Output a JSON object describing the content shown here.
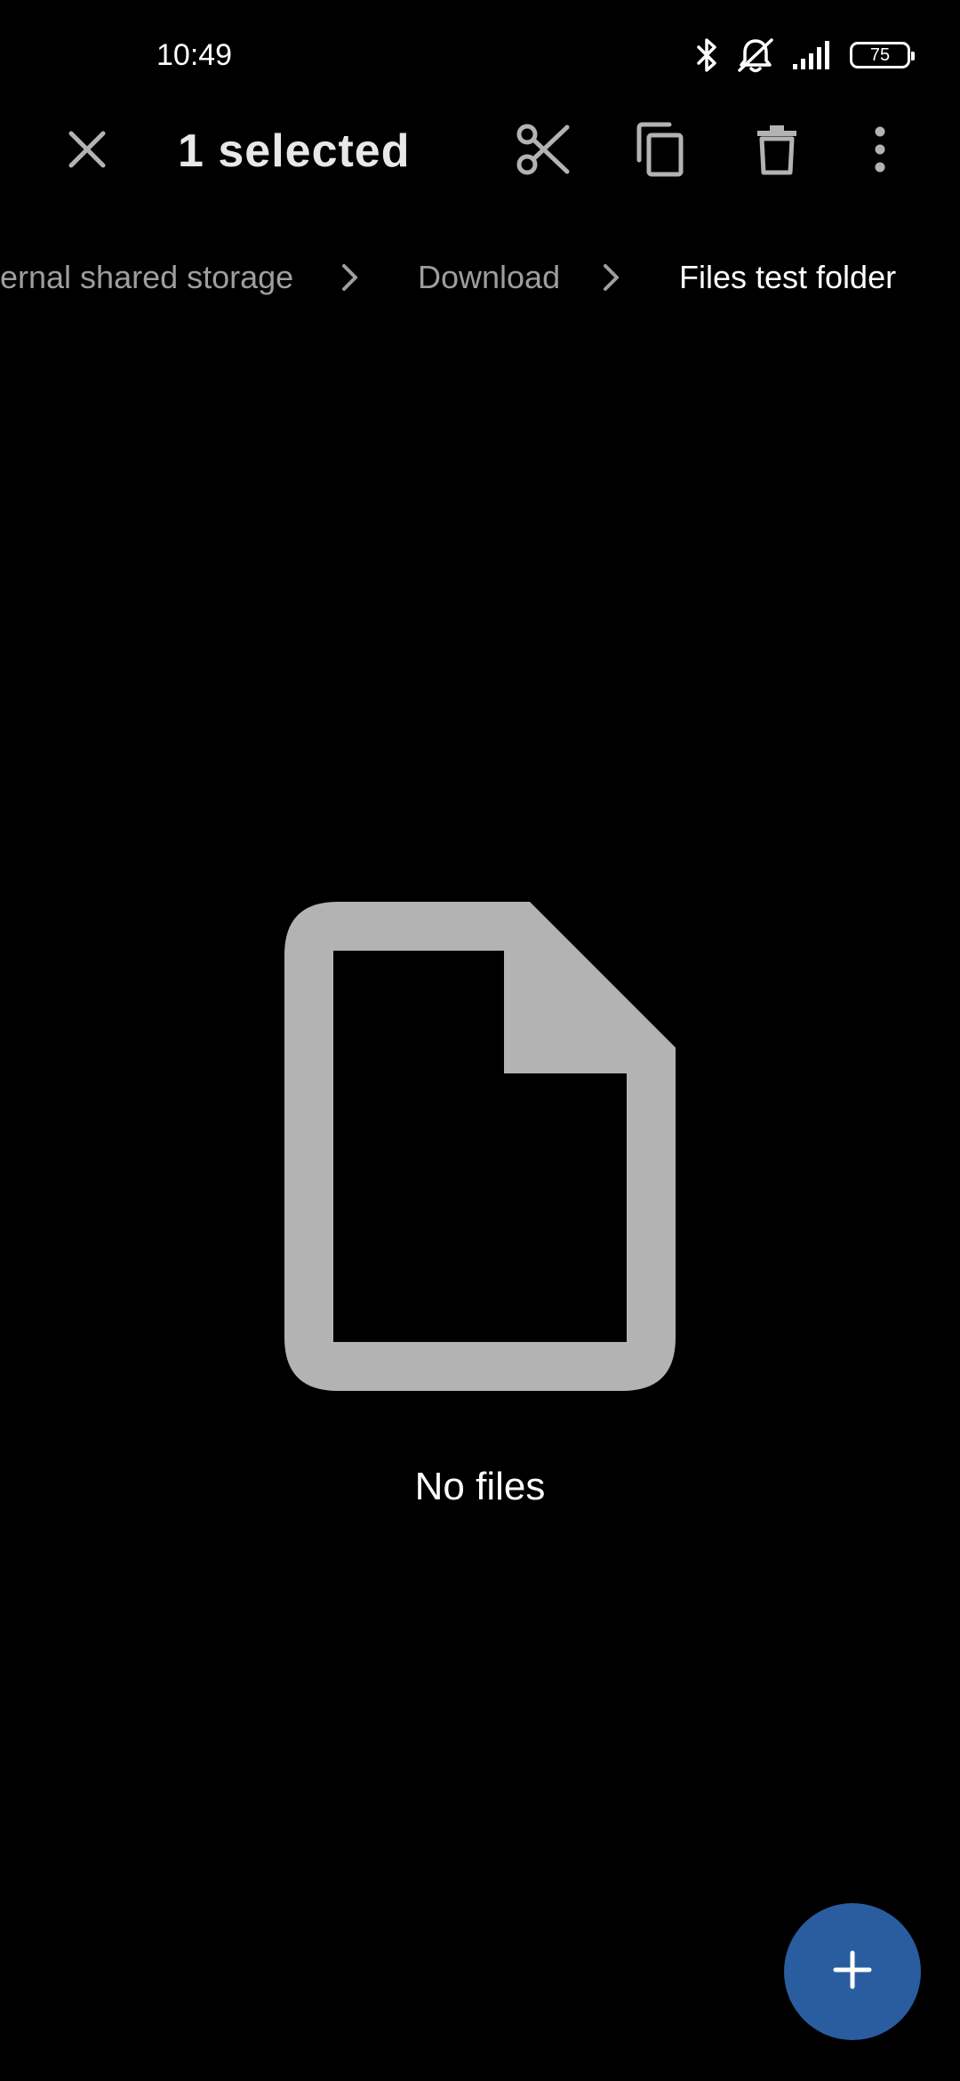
{
  "status_bar": {
    "time": "10:49",
    "battery": "75",
    "icons": [
      "bluetooth-icon",
      "muted-bell-icon",
      "signal-icon",
      "battery-icon"
    ]
  },
  "action_bar": {
    "title": "1 selected",
    "icons": [
      "close-icon",
      "cut-icon",
      "copy-icon",
      "delete-icon",
      "more-vert-icon"
    ]
  },
  "breadcrumb": {
    "items": [
      "Internal shared storage",
      "Download",
      "Files test folder"
    ],
    "visible_first": "ernal shared storage"
  },
  "empty_state": {
    "icon": "file-icon",
    "message": "No files"
  },
  "fab": {
    "icon": "plus-icon"
  },
  "colors": {
    "background": "#000000",
    "icon_gray": "#b3b3b3",
    "fab_blue": "#2a5d9f",
    "breadcrumb_inactive": "#9e9e9e",
    "breadcrumb_active": "#ffffff"
  }
}
